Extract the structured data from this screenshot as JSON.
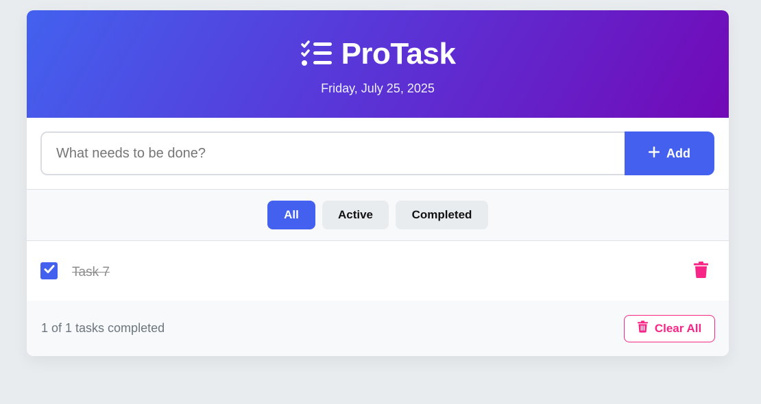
{
  "header": {
    "app_title": "ProTask",
    "date": "Friday, July 25, 2025",
    "icon": "task-list-icon"
  },
  "input": {
    "placeholder": "What needs to be done?",
    "value": "",
    "add_label": "Add",
    "add_icon": "plus-icon"
  },
  "filters": [
    {
      "label": "All",
      "active": true
    },
    {
      "label": "Active",
      "active": false
    },
    {
      "label": "Completed",
      "active": false
    }
  ],
  "tasks": [
    {
      "text": "Task 7",
      "completed": true,
      "delete_icon": "trash-icon"
    }
  ],
  "footer": {
    "status": "1 of 1 tasks completed",
    "clear_label": "Clear All",
    "clear_icon": "trash-icon"
  },
  "colors": {
    "primary": "#4361ee",
    "header_gradient_end": "#7209b7",
    "danger": "#f72585",
    "background": "#e9ecef"
  }
}
